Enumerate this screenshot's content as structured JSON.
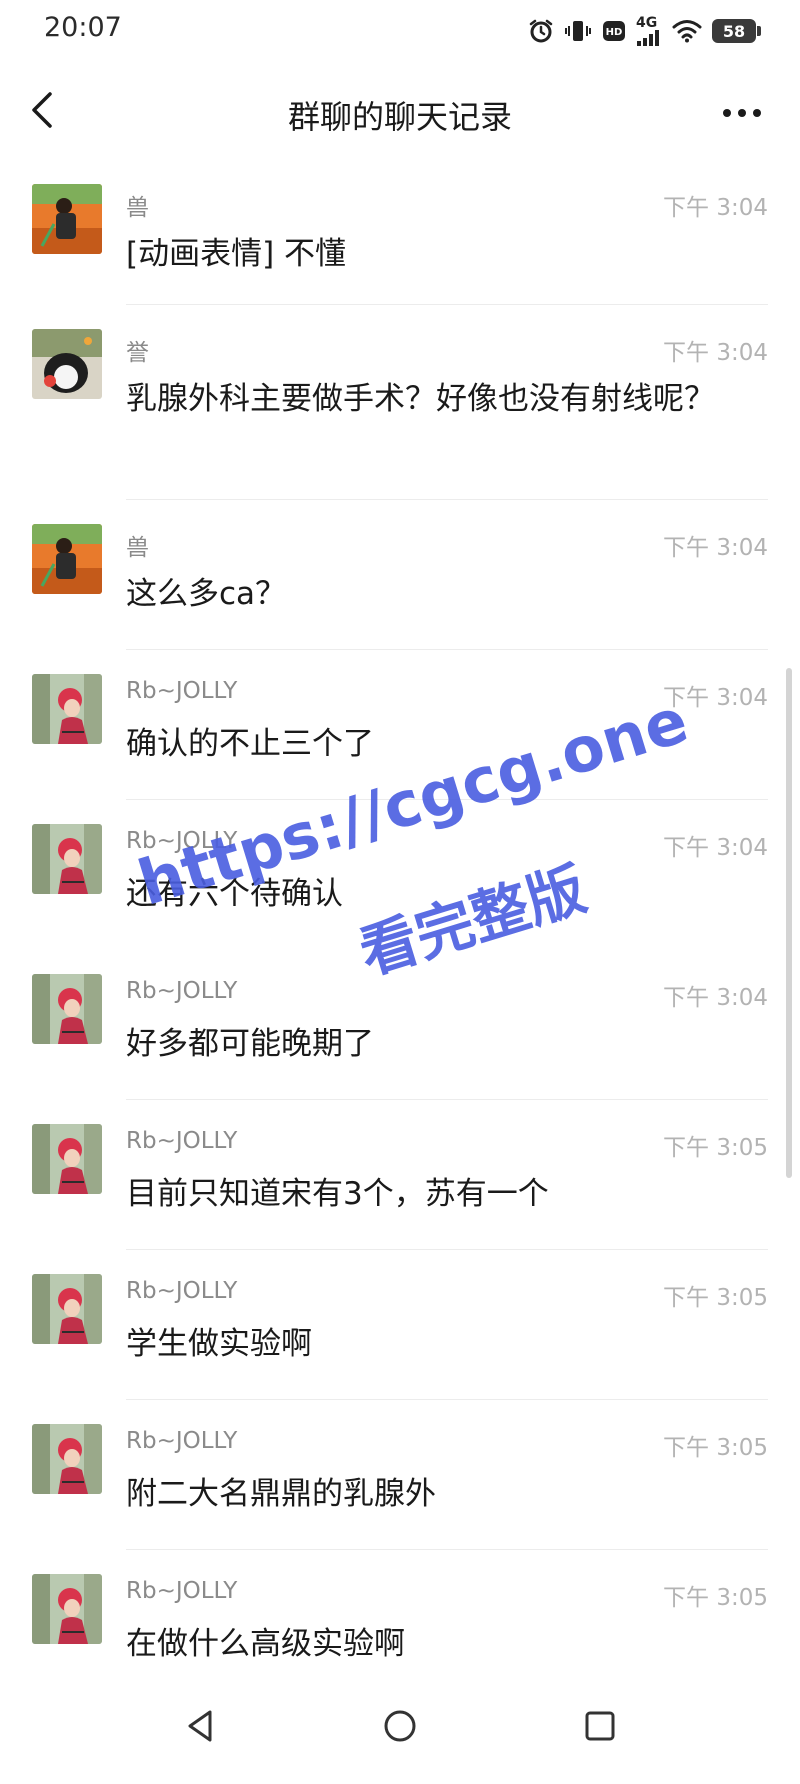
{
  "status_bar": {
    "time": "20:07",
    "network": "4G",
    "hd_label": "HD",
    "battery": "58"
  },
  "header": {
    "title": "群聊的聊天记录",
    "back_icon": "chevron-left-icon",
    "more_icon": "more-dots-icon"
  },
  "messages": [
    {
      "sender": "兽",
      "time": "下午 3:04",
      "text": "[动画表情] 不懂"
    },
    {
      "sender": "誉",
      "time": "下午 3:04",
      "text": "乳腺外科主要做手术？好像也没有射线呢？"
    },
    {
      "sender": "兽",
      "time": "下午 3:04",
      "text": "这么多ca？"
    },
    {
      "sender": "Rb~JOLLY",
      "time": "下午 3:04",
      "text": "确认的不止三个了"
    },
    {
      "sender": "Rb~JOLLY",
      "time": "下午 3:04",
      "text": "还有六个待确认"
    },
    {
      "sender": "Rb~JOLLY",
      "time": "下午 3:04",
      "text": "好多都可能晚期了"
    },
    {
      "sender": "Rb~JOLLY",
      "time": "下午 3:05",
      "text": "目前只知道宋有3个，苏有一个"
    },
    {
      "sender": "Rb~JOLLY",
      "time": "下午 3:05",
      "text": "学生做实验啊"
    },
    {
      "sender": "Rb~JOLLY",
      "time": "下午 3:05",
      "text": "附二大名鼎鼎的乳腺外"
    },
    {
      "sender": "Rb~JOLLY",
      "time": "下午 3:05",
      "text": "在做什么高级实验啊"
    }
  ],
  "watermark": {
    "url": "https://cgcg.one",
    "subtitle": "看完整版"
  },
  "system_nav": {
    "back_icon": "triangle-back-icon",
    "home_icon": "circle-home-icon",
    "recent_icon": "square-recents-icon"
  },
  "colors": {
    "background": "#ffffff",
    "text_primary": "#1a1a1a",
    "text_name": "#8a8a8a",
    "text_time": "#b3b3b3",
    "divider": "#ececec",
    "watermark": "#4a5ee0"
  }
}
